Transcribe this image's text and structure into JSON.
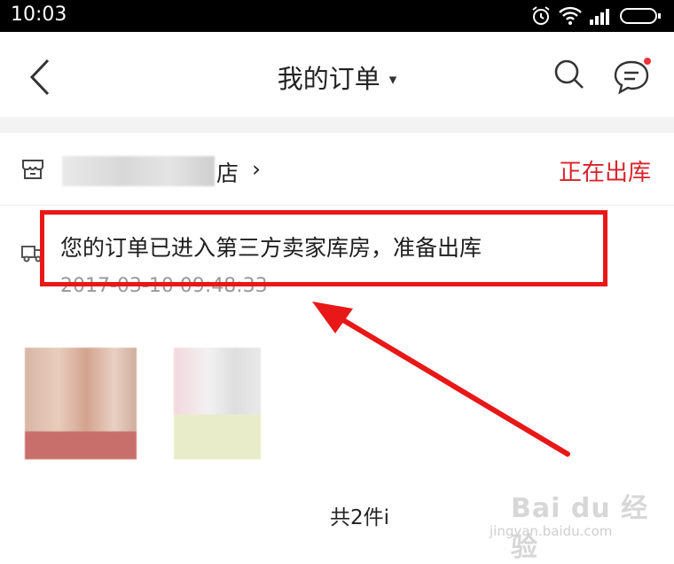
{
  "status_bar": {
    "time": "10:03",
    "icons": [
      "alarm-icon",
      "wifi-icon",
      "signal-icon",
      "battery-icon"
    ]
  },
  "header": {
    "title": "我的订单",
    "caret": "▾",
    "icons": [
      "back-icon",
      "search-icon",
      "message-icon"
    ],
    "notification_dot_color": "#e8343a"
  },
  "shop": {
    "name_suffix": "店",
    "chevron": "›",
    "status": "正在出库",
    "status_color": "#d8232a"
  },
  "logistics": {
    "message": "您的订单已进入第三方卖家库房，准备出库",
    "timestamp": "2017-03-10 09:48:33"
  },
  "summary": {
    "item_count": "共2件i"
  },
  "annotation": {
    "highlight_color": "#e81818"
  },
  "watermark": {
    "brand": "Bai du 经验",
    "url": "jingyan.baidu.com"
  }
}
